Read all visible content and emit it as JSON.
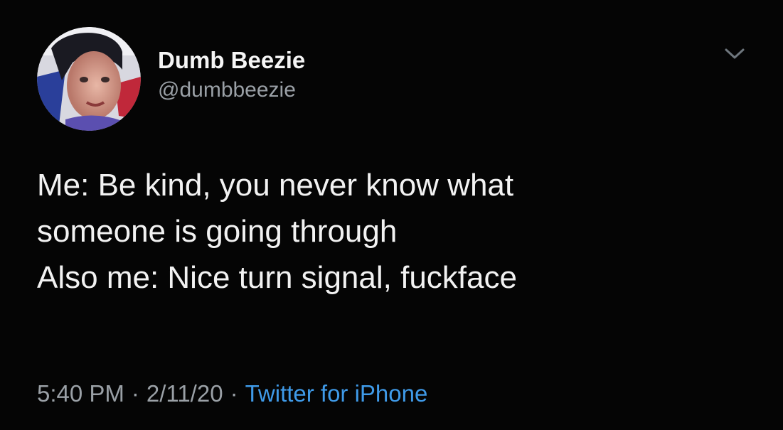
{
  "tweet": {
    "author": {
      "display_name": "Dumb Beezie",
      "handle": "@dumbbeezie",
      "avatar_icon": "profile-photo"
    },
    "menu_icon": "chevron-down-icon",
    "lines": [
      "Me: Be kind, you never know what",
      "someone is going through",
      "Also me: Nice turn signal, fuckface"
    ],
    "meta": {
      "time": "5:40 PM",
      "separator": "·",
      "date": "2/11/20",
      "source": "Twitter for iPhone"
    }
  },
  "colors": {
    "background": "#050505",
    "text": "#f2f2f2",
    "muted": "#9aa0a6",
    "link": "#3f9ae8"
  }
}
